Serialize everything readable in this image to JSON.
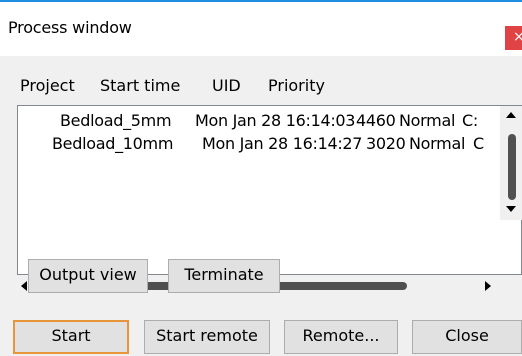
{
  "window": {
    "title": "Process window",
    "close_glyph": "×"
  },
  "process_list": {
    "columns": [
      "Project",
      "Start time",
      "UID",
      "Priority"
    ],
    "rows": [
      {
        "project": "Bedload_5mm",
        "start_time": "Mon Jan 28 16:14:03",
        "uid": "4460",
        "priority": "Normal",
        "extra": "C:"
      },
      {
        "project": "Bedload_10mm",
        "start_time": "Mon Jan 28 16:14:27",
        "uid": "3020",
        "priority": "Normal",
        "extra": "C"
      }
    ]
  },
  "panel_buttons": {
    "output_view": "Output view",
    "terminate": "Terminate"
  },
  "bottom_buttons": {
    "start": "Start",
    "start_remote": "Start remote",
    "remote": "Remote...",
    "close": "Close"
  },
  "colors": {
    "accent_border": "#1e8ee0",
    "close_button": "#e04343",
    "default_button_border": "#e8943a"
  }
}
